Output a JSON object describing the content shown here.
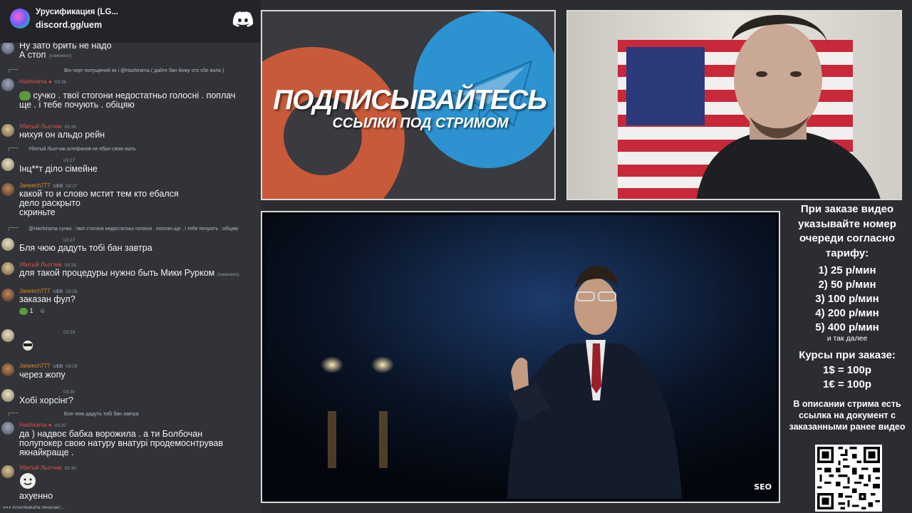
{
  "chat": {
    "server_name": "Урусификация (LG...",
    "server_link": "discord.gg/uem",
    "messages": [
      {
        "text": "Ну зато брить не надо\nА стоп",
        "edited": "(изменено)"
      },
      {
        "reply": "Він чорт попущений як і @Hashirama ( дайте бан йому ото єбе вола )",
        "user": "Hashirama",
        "time": "03:26",
        "text": "сучко . твої стогони недостатньо голосні . поплач\nще . і тебе почують . обіцяю"
      },
      {
        "user": "Убитый Льотчик",
        "time": "03:26",
        "text": "нихуя он альдо рейн"
      },
      {
        "reply": "Убитый Льотчик штефанов не ебал свою мать",
        "user": "",
        "time": "03:27",
        "text": "Інц**т  діло сімейне"
      },
      {
        "user": "Janeech777",
        "badge": "UEB",
        "time": "03:27",
        "text": "какой то и слово мстит тем кто ебался\nдело раскрыто\nскриньте"
      },
      {
        "reply": "@Hashirama сучко . твої стогони недостатньо голосні . поплач ще . і тебе почують . обіцяю",
        "user": "",
        "time": "03:27",
        "text": "Бля чюю дадуть тобі бан завтра"
      },
      {
        "user": "Убитый Льотчик",
        "time": "03:28",
        "text": "для такой процедуры нужно быть Мики Рурком",
        "edited": "(изменено)"
      },
      {
        "user": "Janeech777",
        "badge": "UEB",
        "time": "03:28",
        "text": "заказан фул?",
        "reaction": "1"
      },
      {
        "user": "",
        "time": "03:29",
        "text": ""
      },
      {
        "user": "Janeech777",
        "badge": "UEB",
        "time": "03:29",
        "text": "через жопу"
      },
      {
        "user": "",
        "time": "03:30",
        "text": "Хобі хорсінг?"
      },
      {
        "reply": "Бля чюю дадуть тобі бан завтра",
        "user": "Hashirama",
        "time": "03:30",
        "text": "да ) надвоє бабка ворожила . а ти Болбочан\nполупокер  свою натуру внатурі продемоснтрував\nякнайкраще ."
      },
      {
        "user": "Убитый Льотчик",
        "time": "03:30",
        "text": "ахуенно"
      }
    ],
    "typing": "Arsenikakaha печатает..."
  },
  "promo": {
    "title": "ПОДПИСЫВАЙТЕСЬ",
    "subtitle": "ССЫЛКИ ПОД СТРИМОМ"
  },
  "video": {
    "watermark": "SEO"
  },
  "info": {
    "order_text": "При заказе видео указывайте номер очереди согласно тарифу:",
    "tariffs": [
      "1) 25 р/мин",
      "2) 50 р/мин",
      "3) 100 р/мин",
      "4) 200 р/мин",
      "5) 400 р/мин"
    ],
    "etc": "и так далее",
    "rates_title": "Курсы при заказе:",
    "rates": [
      "1$ = 100р",
      "1€ = 100р"
    ],
    "description": "В описании стрима есть ссылка на документ с заказанными ранее видео"
  },
  "colors": {
    "chat_bg": "#313338",
    "header_bg": "#232428",
    "username_red": "#e4524a",
    "promo_red": "#c85a3a",
    "promo_blue": "#2d92d0"
  }
}
